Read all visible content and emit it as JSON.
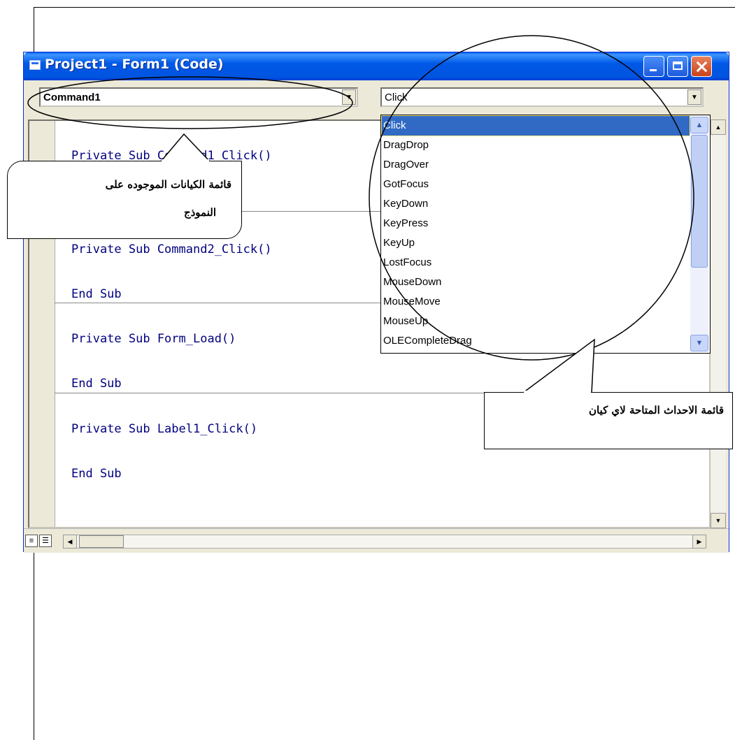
{
  "window": {
    "title": "Project1 - Form1 (Code)"
  },
  "object_combo": {
    "value": "Command1"
  },
  "event_combo": {
    "value": "Click"
  },
  "code_lines": [
    "Private Sub Command1_Click()",
    "Private Sub Command2_Click()",
    "End Sub",
    "Private Sub Form_Load()",
    "End Sub",
    "Private Sub Label1_Click()",
    "End Sub"
  ],
  "event_list": {
    "items": [
      "Click",
      "DragDrop",
      "DragOver",
      "GotFocus",
      "KeyDown",
      "KeyPress",
      "KeyUp",
      "LostFocus",
      "MouseDown",
      "MouseMove",
      "MouseUp",
      "OLECompleteDrag"
    ],
    "selected": "Click"
  },
  "callouts": {
    "objects_line1": "قائمة الكيانات الموجوده على",
    "objects_line2": "النموذج",
    "events": "قائمة الاحداث المتاحة لاي كيان"
  },
  "colors": {
    "titlebar": "#0058e6",
    "keyword": "#000080",
    "selection": "#316ac5"
  }
}
